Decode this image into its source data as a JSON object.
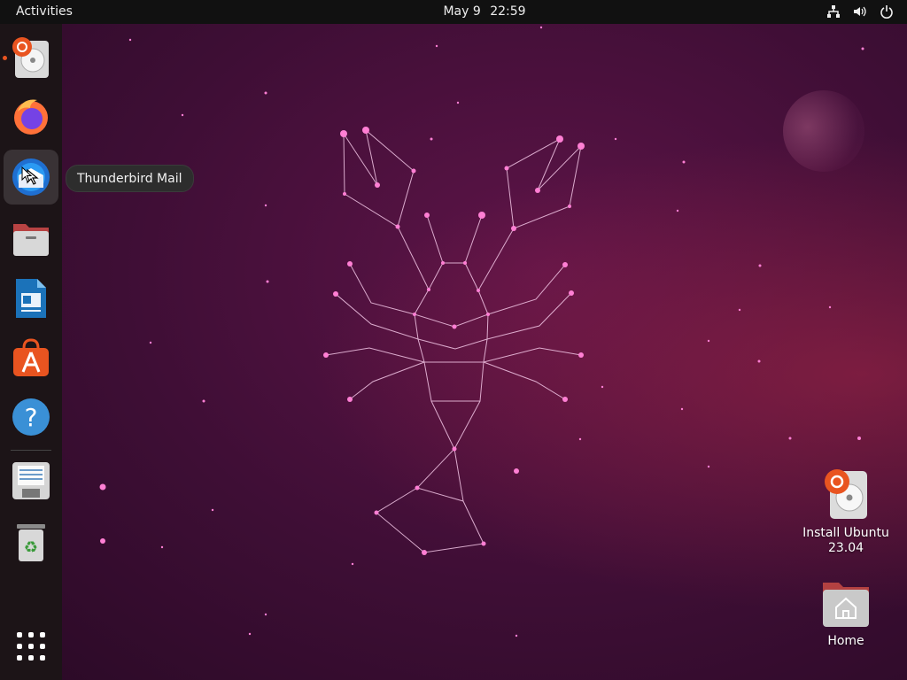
{
  "topbar": {
    "activities": "Activities",
    "date": "May 9",
    "time": "22:59",
    "tray_icons": [
      "network-icon",
      "volume-icon",
      "power-icon"
    ]
  },
  "dock": {
    "items": [
      {
        "name": "Install Ubuntu",
        "icon": "installer-icon",
        "running": true
      },
      {
        "name": "Firefox",
        "icon": "firefox-icon",
        "running": false
      },
      {
        "name": "Thunderbird Mail",
        "icon": "thunderbird-icon",
        "running": false,
        "hovered": true
      },
      {
        "name": "Files",
        "icon": "files-icon",
        "running": false
      },
      {
        "name": "LibreOffice Writer",
        "icon": "writer-icon",
        "running": false
      },
      {
        "name": "Ubuntu Software",
        "icon": "software-icon",
        "running": false
      },
      {
        "name": "Help",
        "icon": "help-icon",
        "running": false
      },
      {
        "name": "Save",
        "icon": "save-icon",
        "running": false
      },
      {
        "name": "Trash",
        "icon": "trash-icon",
        "running": false
      },
      {
        "name": "Show Applications",
        "icon": "app-grid-icon",
        "running": false
      }
    ]
  },
  "tooltip": {
    "text": "Thunderbird Mail"
  },
  "desktop_icons": [
    {
      "label_line1": "Install Ubuntu",
      "label_line2": "23.04",
      "icon": "installer-icon"
    },
    {
      "label_line1": "Home",
      "label_line2": "",
      "icon": "home-folder-icon"
    }
  ],
  "colors": {
    "topbar": "#111111",
    "dock": "#1c1417",
    "accent": "#e95420",
    "wallpaper": "#3e0e35",
    "constellation": "#ff66cc"
  }
}
